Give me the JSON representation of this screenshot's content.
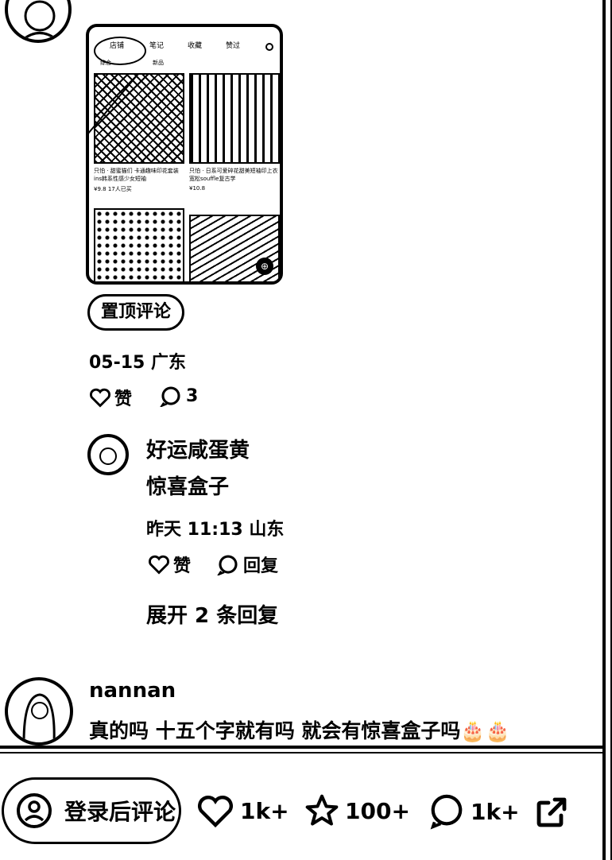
{
  "embedded_shot": {
    "tabs": [
      "店铺",
      "笔记",
      "收藏",
      "赞过"
    ],
    "subtabs": [
      "综合",
      "新品"
    ],
    "products": [
      {
        "caption": "只怕 · 甜蜜猫们 卡通趣味印花套装ins韩系性感少女短袖",
        "price": "¥9.8",
        "sold": "17人已买"
      },
      {
        "caption": "只怕 · 日系可爱碎花甜美短袖印上衣宽松souffle复古学",
        "price": "¥10.8",
        "sold": ""
      }
    ]
  },
  "pinned_label": "置顶评论",
  "comment_meta": "05-15 广东",
  "comment_actions": {
    "like": "赞",
    "reply_count": "3"
  },
  "reply": {
    "name": "好运咸蛋黄",
    "text": "惊喜盒子",
    "meta": "昨天 11:13 山东",
    "like": "赞",
    "reply": "回复"
  },
  "expand_label": "展开 2 条回复",
  "comment2": {
    "name": "nannan",
    "text": "真的吗 十五个字就有吗 就会有惊喜盒子吗🎂🎂"
  },
  "bottom_bar": {
    "login_label": "登录后评论",
    "likes": "1k+",
    "stars": "100+",
    "comments": "1k+"
  }
}
